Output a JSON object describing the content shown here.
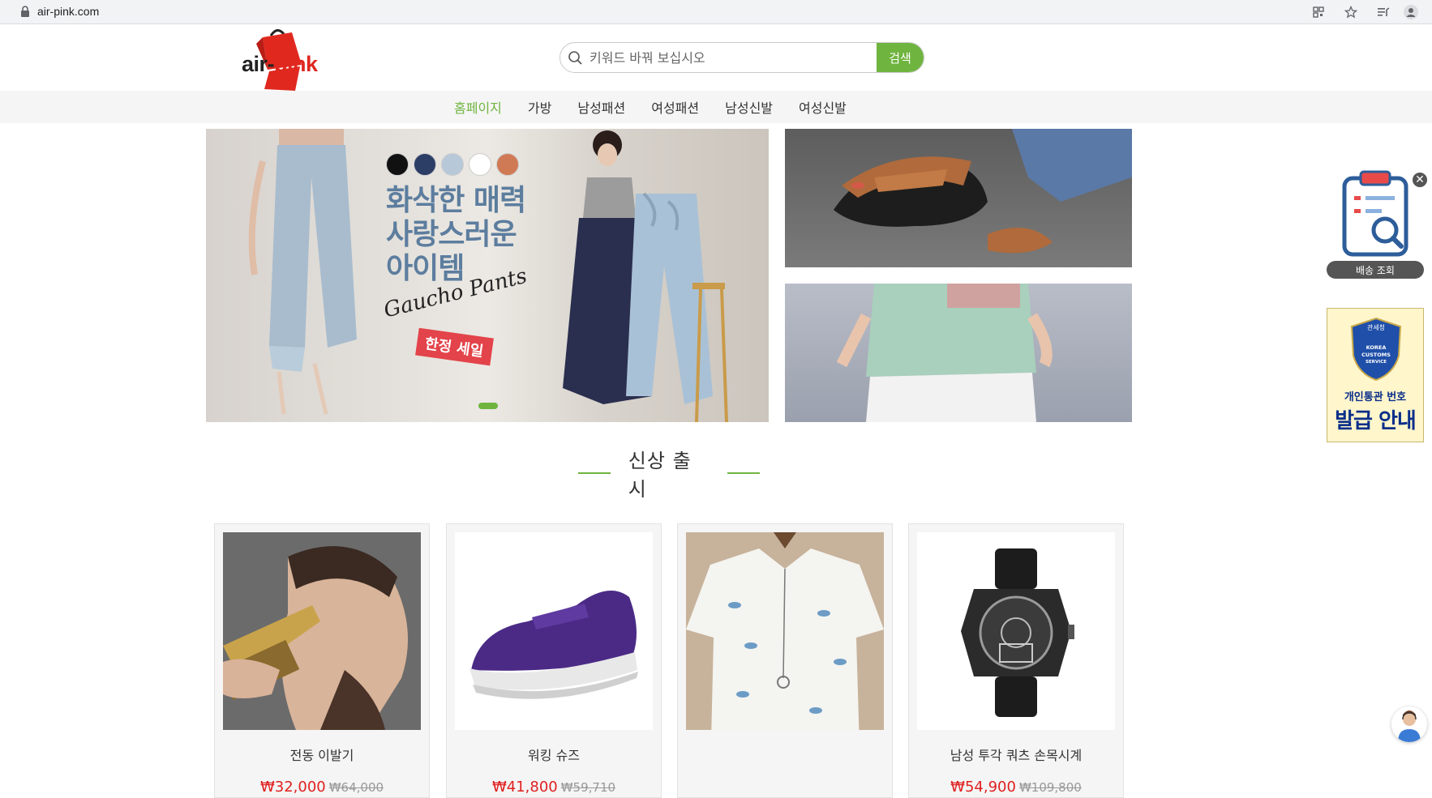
{
  "browser": {
    "url": "air-pink.com"
  },
  "header": {
    "logo_text_main": "air-",
    "logo_text_accent": "pink",
    "search_placeholder": "키워드 바꿔 보십시오",
    "search_button": "검색"
  },
  "nav": {
    "items": [
      {
        "label": "홈페이지"
      },
      {
        "label": "가방"
      },
      {
        "label": "남성패션"
      },
      {
        "label": "여성패션"
      },
      {
        "label": "남성신발"
      },
      {
        "label": "여성신발"
      }
    ]
  },
  "banner": {
    "headline_1": "화삭한 매력",
    "headline_2": "사랑스러운",
    "headline_3": "아이템",
    "script_text": "Gaucho Pants",
    "sale_badge": "한정 세일",
    "swatch_colors": [
      "#111111",
      "#2c3d66",
      "#b7c9d9",
      "#ffffff",
      "#d07a55"
    ]
  },
  "section": {
    "title": "신상 출시"
  },
  "products": [
    {
      "name": "전동 이발기",
      "price": "₩32,000",
      "old_price": "₩64,000"
    },
    {
      "name": "워킹 슈즈",
      "price": "₩41,800",
      "old_price": "₩59,710"
    },
    {
      "name": "",
      "price": "",
      "old_price": ""
    },
    {
      "name": "남성 투각 쿼츠 손목시계",
      "price": "₩54,900",
      "old_price": "₩109,800"
    }
  ],
  "widgets": {
    "shipping_label": "배송 조회",
    "customs_line1": "개인통관 번호",
    "customs_line2": "발급 안내",
    "customs_seal_top": "관세청",
    "customs_seal_text": "KOREA CUSTOMS SERVICE"
  },
  "colors": {
    "accent_green": "#6fb43f",
    "price_red": "#e02020",
    "logo_red": "#e0281f"
  }
}
